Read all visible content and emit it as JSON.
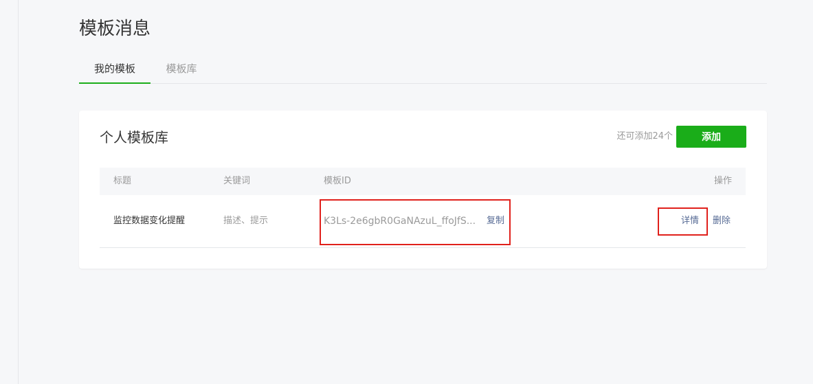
{
  "page": {
    "title": "模板消息"
  },
  "tabs": [
    {
      "label": "我的模板",
      "active": true
    },
    {
      "label": "模板库",
      "active": false
    }
  ],
  "card": {
    "title": "个人模板库",
    "quota_text": "还可添加24个",
    "add_label": "添加"
  },
  "table": {
    "headers": {
      "title": "标题",
      "keywords": "关键词",
      "template_id": "模板ID",
      "operations": "操作"
    },
    "rows": [
      {
        "title": "监控数据变化提醒",
        "keywords": "描述、提示",
        "template_id": "K3Ls-2e6gbR0GaNAzuL_ffoJfS...",
        "copy_label": "复制",
        "detail_label": "详情",
        "delete_label": "删除"
      }
    ]
  },
  "colors": {
    "accent": "#1aad19",
    "link": "#576b95",
    "highlight_border": "#e0201b"
  }
}
